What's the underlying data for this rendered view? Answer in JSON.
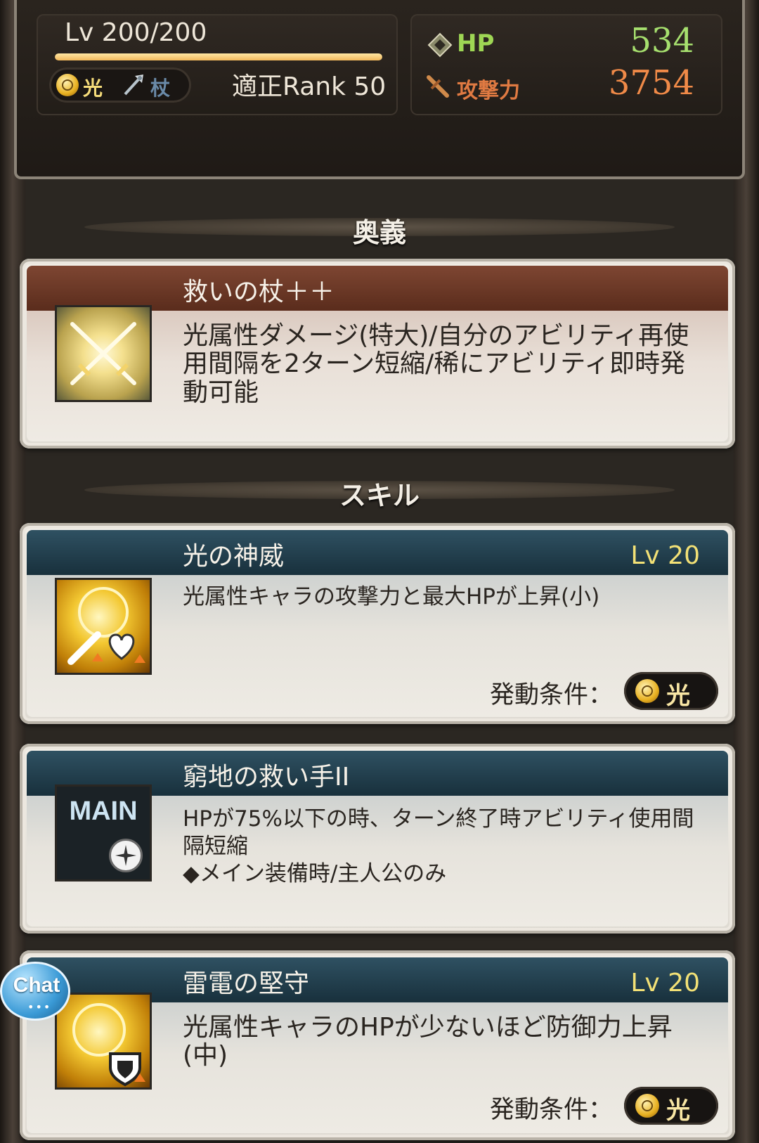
{
  "status": {
    "level": "Lv 200/200",
    "level_progress": 1.0,
    "attribute": "光",
    "weapon_type": "杖",
    "rank": "適正Rank 50",
    "hp_label": "HP",
    "hp_value": "534",
    "atk_label": "攻撃力",
    "atk_value": "3754"
  },
  "ougi": {
    "section_title": "奥義",
    "name": "救いの杖＋＋",
    "description": "光属性ダメージ(特大)/自分のアビリティ再使用間隔を2ターン短縮/稀にアビリティ即時発動可能",
    "icon": "crossed-swords-icon"
  },
  "skills": {
    "section_title": "スキル",
    "items": [
      {
        "name": "光の神威",
        "level": "Lv 20",
        "description": "光属性キャラの攻撃力と最大HPが上昇(小)",
        "condition_label": "発動条件：",
        "condition_value": "光",
        "icon": "light-might-icon"
      },
      {
        "name": "窮地の救い手II",
        "description_lines": [
          "HPが75%以下の時、ターン終了時アビリティ使用間隔短縮",
          "◆メイン装備時/主人公のみ"
        ],
        "icon_label": "MAIN",
        "icon": "main-weapon-icon"
      },
      {
        "name": "雷電の堅守",
        "level": "Lv 20",
        "description": "光属性キャラのHPが少ないほど防御力上昇(中)",
        "condition_label": "発動条件：",
        "condition_value": "光",
        "icon": "light-defense-icon"
      }
    ]
  },
  "chat": {
    "label": "Chat",
    "dots": "•••"
  },
  "colors": {
    "hp": "#a6df6e",
    "atk": "#f08a48",
    "skill_lv": "#f3e176",
    "ougi_header": "#6b3826",
    "skill_header": "#23404e"
  }
}
